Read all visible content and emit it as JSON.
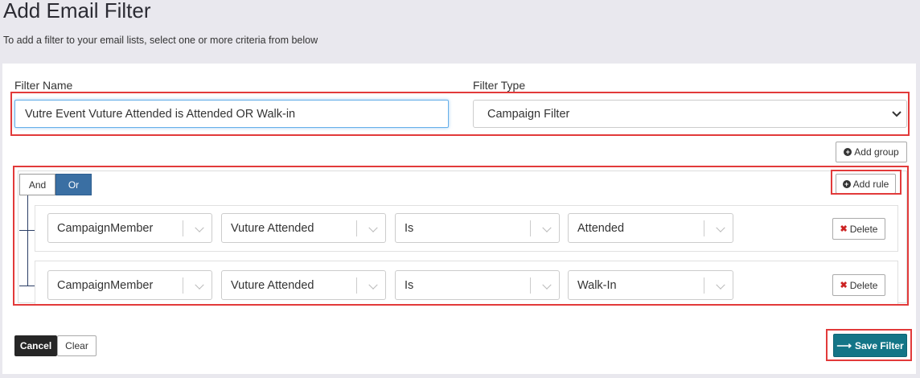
{
  "page": {
    "title": "Add Email Filter",
    "subtitle": "To add a filter to your email lists, select one or more criteria from below"
  },
  "form": {
    "filter_name_label": "Filter Name",
    "filter_name_value": "Vutre Event Vuture Attended is Attended OR Walk-in",
    "filter_type_label": "Filter Type",
    "filter_type_value": "Campaign Filter"
  },
  "builder": {
    "add_group_label": "Add group",
    "add_rule_label": "Add rule",
    "condition_and": "And",
    "condition_or": "Or",
    "active_condition": "Or",
    "rules": [
      {
        "object": "CampaignMember",
        "field": "Vuture Attended",
        "operator": "Is",
        "value": "Attended",
        "delete_label": "Delete"
      },
      {
        "object": "CampaignMember",
        "field": "Vuture Attended",
        "operator": "Is",
        "value": "Walk-In",
        "delete_label": "Delete"
      }
    ]
  },
  "footer": {
    "cancel_label": "Cancel",
    "clear_label": "Clear",
    "save_label": "Save Filter"
  },
  "colors": {
    "highlight_frame": "#e23a3a",
    "or_active": "#3a6fa3",
    "save_button": "#137587",
    "cancel_button": "#262626"
  }
}
